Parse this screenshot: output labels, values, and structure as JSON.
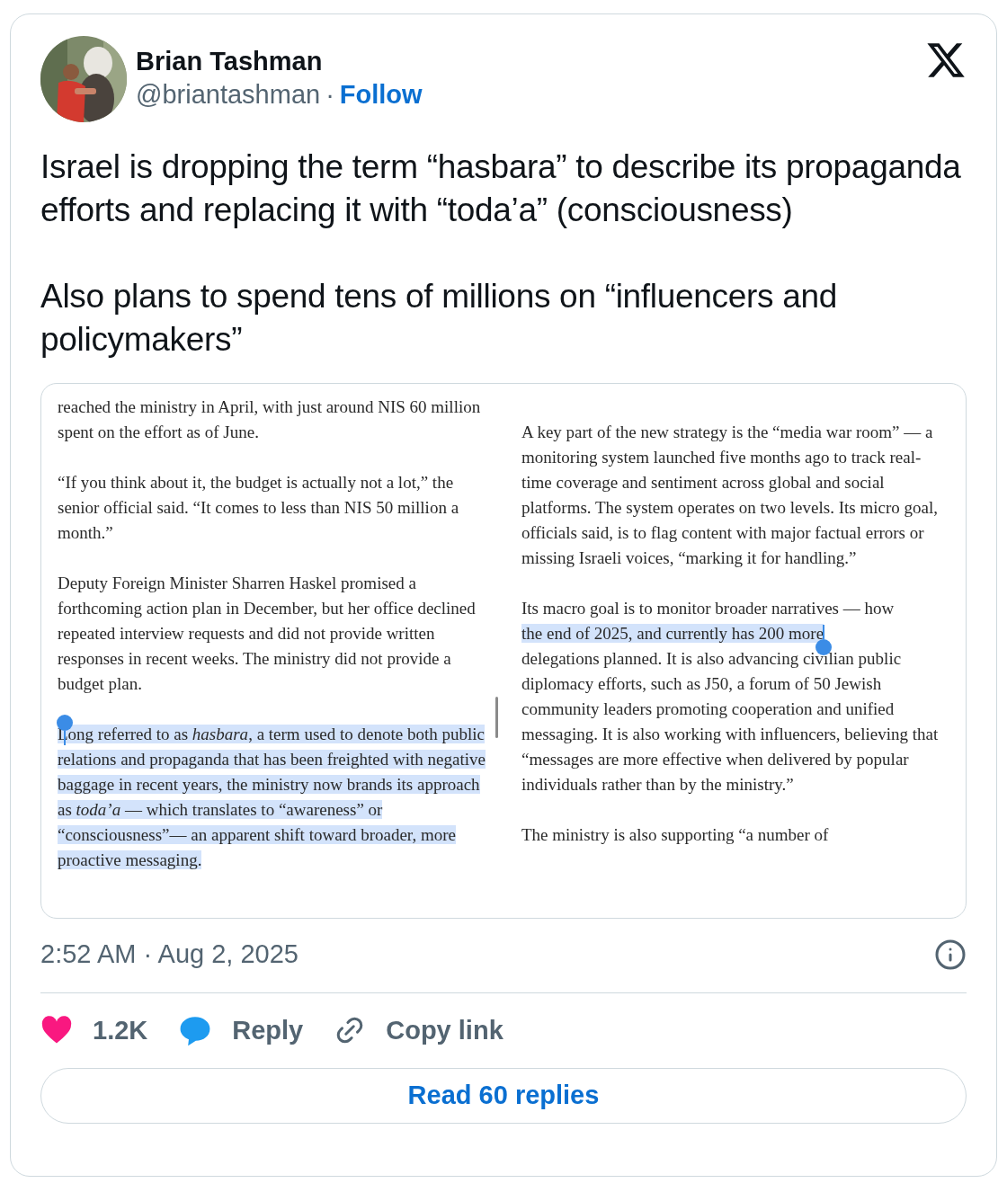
{
  "author": {
    "name": "Brian Tashman",
    "handle": "@briantashman",
    "separator": "·",
    "follow": "Follow"
  },
  "tweet": {
    "paragraphs": [
      "Israel is dropping the term “hasbara” to describe its propaganda efforts and replacing it with “toda’a” (consciousness)",
      "Also plans to spend tens of millions on “influencers and policymakers”"
    ]
  },
  "article": {
    "columns": [
      [
        {
          "kind": "continued",
          "selected": false,
          "text": "reached the ministry in April, with just around NIS 60 million spent on the effort as of June."
        },
        {
          "kind": "paragraph",
          "selected": false,
          "text": "“If you think about it, the budget is actually not a lot,” the senior official said. “It comes to less than NIS 50 million a month.”"
        },
        {
          "kind": "paragraph",
          "selected": false,
          "text": "Deputy Foreign Minister Sharren Haskel promised a forthcoming action plan in December, but her office declined repeated interview requests and did not provide written responses in recent weeks. The ministry did not provide a budget plan."
        },
        {
          "kind": "paragraph",
          "selected": true,
          "text": "Long referred to as *hasbara*, a term used to denote both public relations and propaganda that has been freighted with negative baggage in recent years, the ministry now brands its approach as *toda’a* — which translates to “awareness” or “consciousness”— an apparent shift toward broader, more proactive messaging."
        }
      ],
      [
        {
          "kind": "paragraph",
          "selected": false,
          "text": "A key part of the new strategy is the “media war room” — a monitoring system launched five months ago to track real-time coverage and sentiment across global and social platforms. The system operates on two levels. Its micro goal, officials said, is to flag content with major factual errors or missing Israeli voices, “marking it for handling.”"
        },
        {
          "kind": "paragraph",
          "selected": false,
          "text": "Its macro goal is to monitor broader narratives — how"
        },
        {
          "kind": "continued",
          "selected": true,
          "text": "the end of 2025, and currently has 200 more"
        },
        {
          "kind": "continued",
          "selected": false,
          "text": "delegations planned. It is also advancing civilian public diplomacy efforts, such as J50, a forum of 50 Jewish community leaders promoting cooperation and unified messaging. It is also working with influencers, believing that “messages are more effective when delivered by popular individuals rather than by the ministry.”"
        },
        {
          "kind": "paragraph",
          "selected": false,
          "text": "The ministry is also supporting “a number of"
        }
      ]
    ]
  },
  "timestamp": "2:52 AM · Aug 2, 2025",
  "actions": [
    {
      "kind": "like",
      "label": "1.2K"
    },
    {
      "kind": "reply",
      "label": "Reply"
    },
    {
      "kind": "copy",
      "label": "Copy link"
    }
  ],
  "read_replies": "Read 60 replies"
}
